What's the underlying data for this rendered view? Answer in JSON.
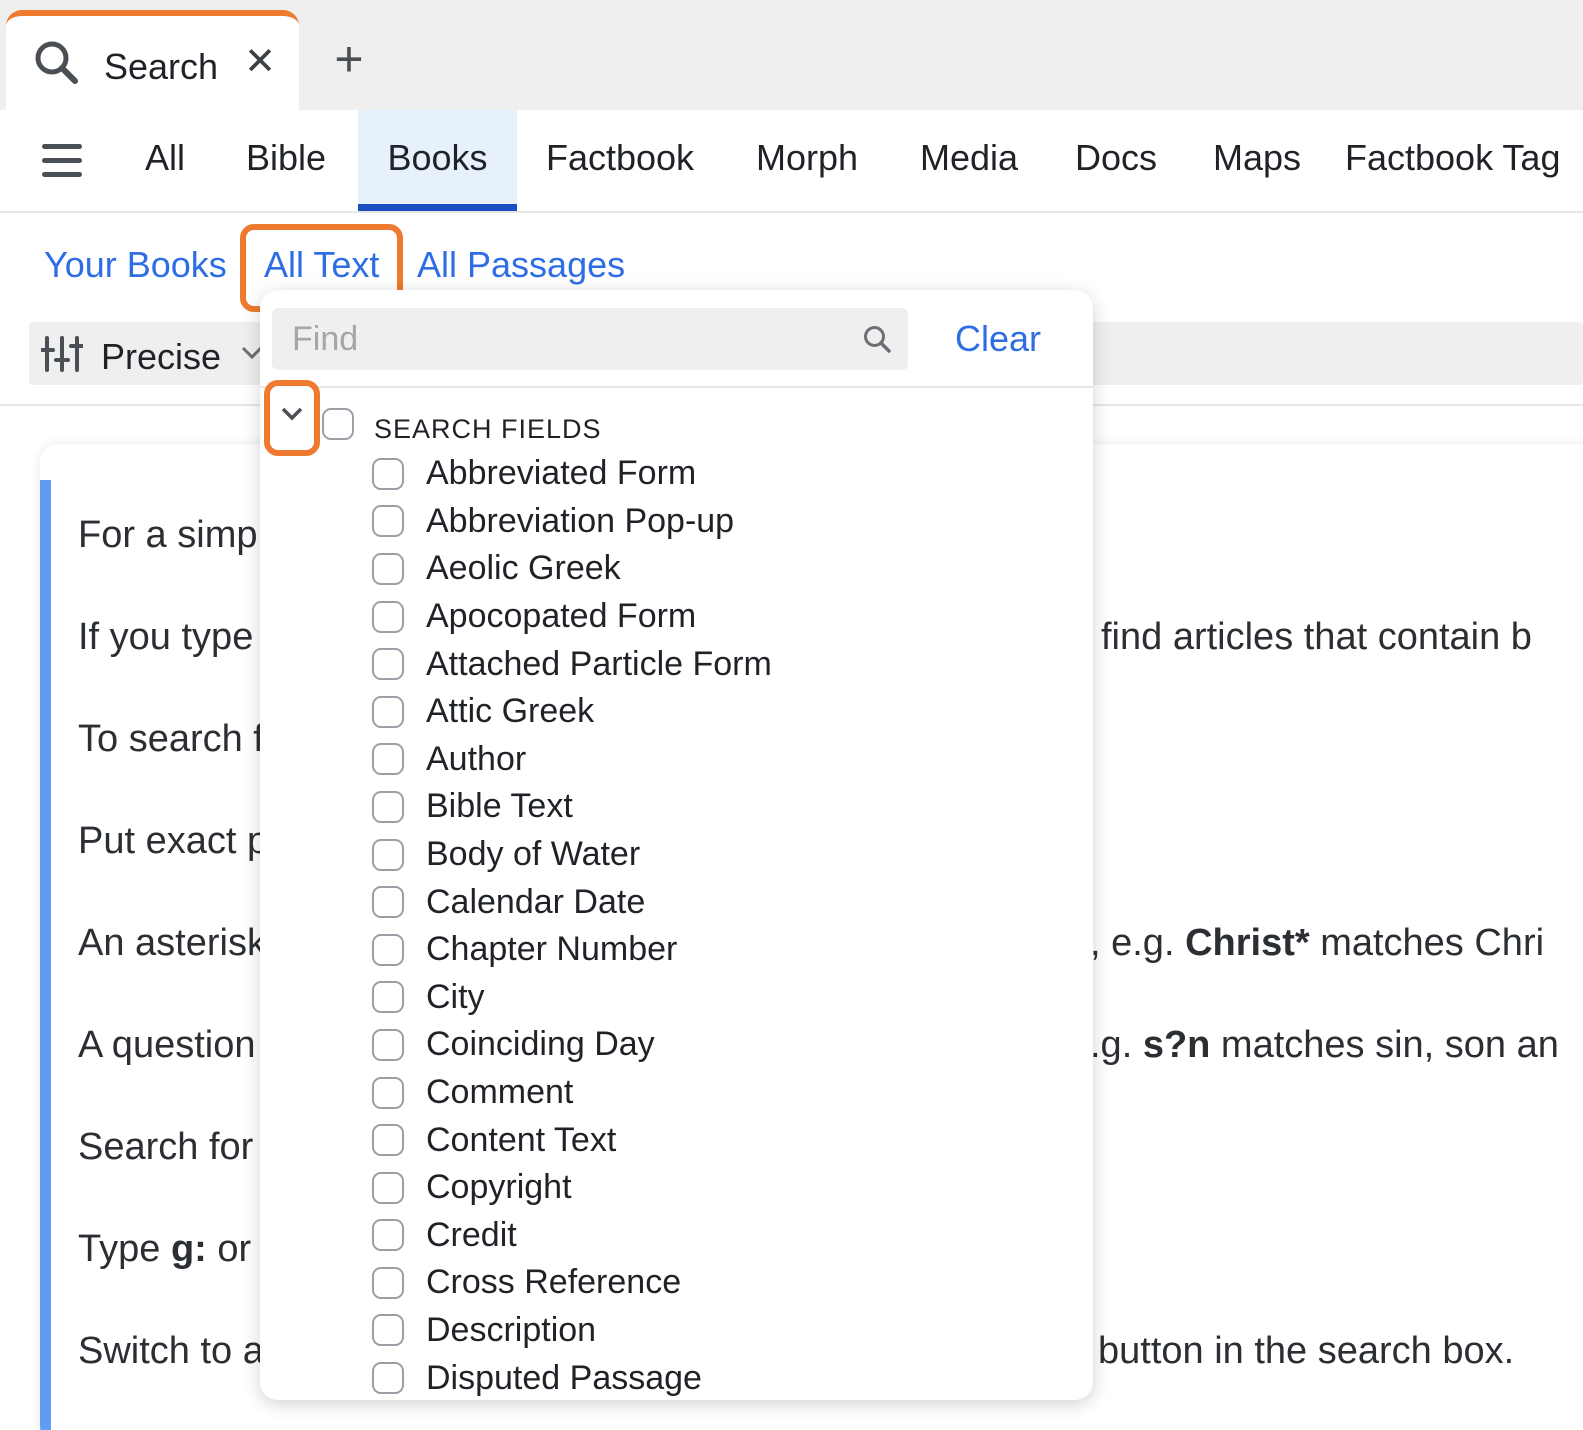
{
  "tabs": {
    "active_label": "Search",
    "close_glyph": "✕",
    "add_glyph": "+"
  },
  "categories": [
    "All",
    "Bible",
    "Books",
    "Factbook",
    "Morph",
    "Media",
    "Docs",
    "Maps",
    "Factbook Tag"
  ],
  "active_category": "Books",
  "subtabs": [
    "Your Books",
    "All Text",
    "All Passages"
  ],
  "active_subtab": "All Text",
  "search_mode": {
    "label": "Precise"
  },
  "dropdown": {
    "find_placeholder": "Find",
    "clear_label": "Clear",
    "group_title": "SEARCH FIELDS",
    "fields": [
      "Abbreviated Form",
      "Abbreviation Pop-up",
      "Aeolic Greek",
      "Apocopated Form",
      "Attached Particle Form",
      "Attic Greek",
      "Author",
      "Bible Text",
      "Body of Water",
      "Calendar Date",
      "Chapter Number",
      "City",
      "Coinciding Day",
      "Comment",
      "Content Text",
      "Copyright",
      "Credit",
      "Cross Reference",
      "Description",
      "Disputed Passage"
    ]
  },
  "help_lines": {
    "l1": "For a simp",
    "l2a": "If you type",
    "l2b": "find articles that contain b",
    "l3": "To search f",
    "l4": "Put exact p",
    "l5a": "An asterisk",
    "l5b1": ", e.g. ",
    "l5b2": "Christ*",
    "l5b3": " matches Chri",
    "l6a": "A question",
    "l6b1": ".g. ",
    "l6b2": "s?n",
    "l6b3": " matches sin, son an",
    "l7": "Search for",
    "l8a": "Type ",
    "l8b": "g:",
    "l8c": " or",
    "l9a": "Switch to a",
    "l9b": "button in the search box."
  },
  "colors": {
    "accent_orange": "#ee7a2f",
    "link_blue": "#2e6de4",
    "active_tab_underline": "#1d4fc4",
    "card_bar": "#5f9cf4"
  },
  "icons": {
    "tab": "search-icon",
    "menu": "hamburger-icon",
    "mode": "sliders-icon",
    "expander": "chevron-down-icon"
  }
}
